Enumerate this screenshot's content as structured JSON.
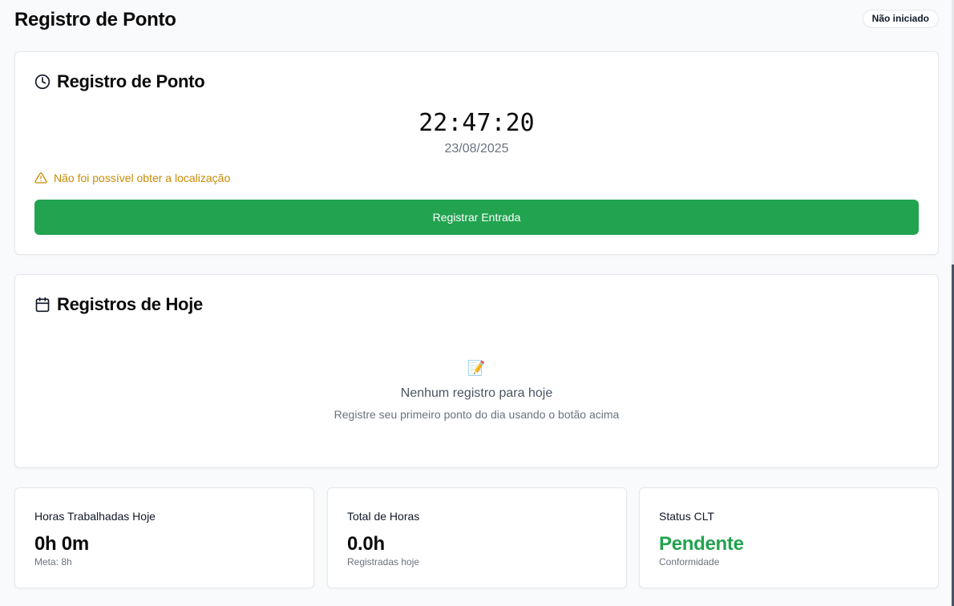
{
  "header": {
    "title": "Registro de Ponto",
    "status_badge": "Não iniciado"
  },
  "punch_card": {
    "title": "Registro de Ponto",
    "icon": "clock-icon",
    "time": "22:47:20",
    "date": "23/08/2025",
    "warning": "Não foi possível obter a localização",
    "warning_color": "#ca8a04",
    "button_label": "Registrar Entrada",
    "button_color": "#22a34f"
  },
  "today_card": {
    "title": "Registros de Hoje",
    "icon": "calendar-icon",
    "empty_emoji": "📝",
    "empty_title": "Nenhum registro para hoje",
    "empty_subtitle": "Registre seu primeiro ponto do dia usando o botão acima"
  },
  "stats": [
    {
      "label": "Horas Trabalhadas Hoje",
      "value": "0h 0m",
      "sub": "Meta: 8h"
    },
    {
      "label": "Total de Horas",
      "value": "0.0h",
      "sub": "Registradas hoje"
    },
    {
      "label": "Status CLT",
      "value": "Pendente",
      "sub": "Conformidade",
      "value_color": "#22a34f"
    }
  ]
}
